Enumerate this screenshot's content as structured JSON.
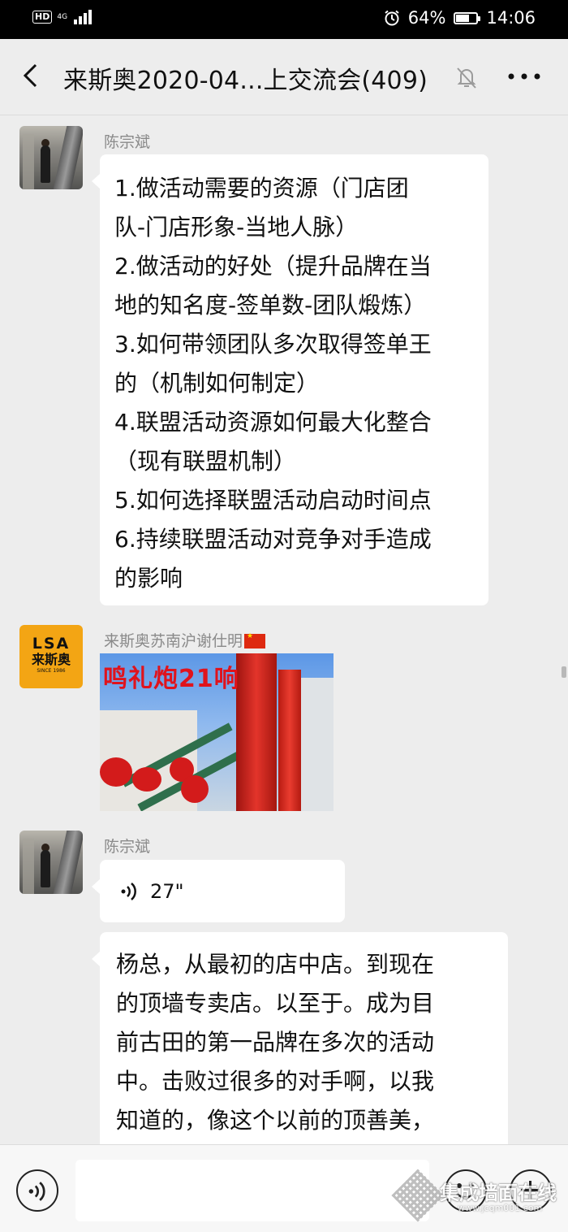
{
  "status_bar": {
    "hd": "HD",
    "network": "4G",
    "battery_percent": "64%",
    "battery_level": 0.64,
    "time": "14:06"
  },
  "header": {
    "title": "来斯奥2020-04...上交流会(409)",
    "icons": [
      "back-icon",
      "mute-bell-icon",
      "more-icon"
    ]
  },
  "messages": [
    {
      "sender": "陈宗斌",
      "lines": [
        "1.做活动需要的资源（门店团",
        "队-门店形象-当地人脉）",
        "2.做活动的好处（提升品牌在当",
        "地的知名度-签单数-团队煅炼）",
        "3.如何带领团队多次取得签单王",
        "的（机制如何制定）",
        "4.联盟活动资源如何最大化整合",
        "（现有联盟机制）",
        "5.如何选择联盟活动启动时间点",
        "6.持续联盟活动对竞争对手造成",
        "的影响"
      ]
    },
    {
      "sender": "来斯奥苏南沪谢仕明",
      "image_caption": "鸣礼炮21响",
      "avatar_logo": {
        "brand": "LSA",
        "cn": "来斯奥",
        "since": "SINCE 1986"
      }
    },
    {
      "sender": "陈宗斌",
      "voice_duration": "27\""
    },
    {
      "lines": [
        "杨总，从最初的店中店。到现在",
        "的顶墙专卖店。以至于。成为目",
        "前古田的第一品牌在多次的活动",
        "中。击败过很多的对手啊，以我",
        "知道的，像这个以前的顶善美，"
      ]
    }
  ],
  "watermark": {
    "text": "集成墙面在线",
    "url": "www.jcqm001.com"
  },
  "colors": {
    "background": "#ededed",
    "bubble": "#ffffff",
    "sender_name": "#8a8a8a",
    "logo": "#f3a514"
  }
}
